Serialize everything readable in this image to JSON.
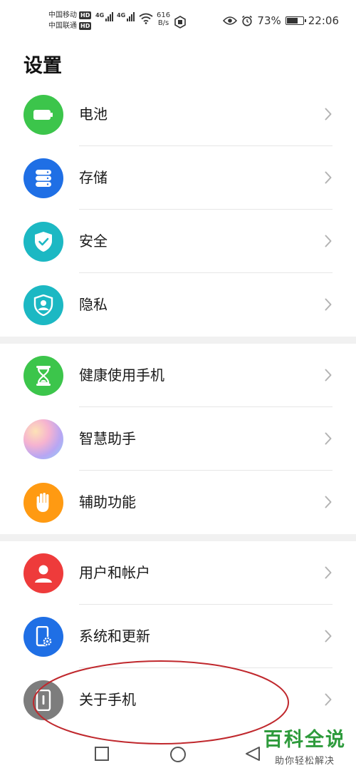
{
  "status_bar": {
    "carrier_1": "中国移动",
    "carrier_2": "中国联通",
    "hd": "HD",
    "network_1": "4G",
    "network_2": "4G",
    "speed_value": "616",
    "speed_unit": "B/s",
    "battery_percent": "73%",
    "battery_level": 0.73,
    "time": "22:06",
    "icons": [
      "eye-icon",
      "alarm-icon",
      "wifi-icon",
      "signal-icon",
      "battery-icon"
    ]
  },
  "header": {
    "title": "设置"
  },
  "groups": [
    {
      "items": [
        {
          "label": "电池",
          "icon": "battery-icon",
          "color": "#3cc54b"
        },
        {
          "label": "存储",
          "icon": "storage-icon",
          "color": "#1f6fe5"
        },
        {
          "label": "安全",
          "icon": "shield-check-icon",
          "color": "#1cb8c3"
        },
        {
          "label": "隐私",
          "icon": "privacy-icon",
          "color": "#1cb8c3"
        }
      ]
    },
    {
      "items": [
        {
          "label": "健康使用手机",
          "icon": "hourglass-icon",
          "color": "#3cc54b"
        },
        {
          "label": "智慧助手",
          "icon": "assistant-icon",
          "color": "#d7a3e8"
        },
        {
          "label": "辅助功能",
          "icon": "hand-icon",
          "color": "#ff9a12"
        }
      ]
    },
    {
      "items": [
        {
          "label": "用户和帐户",
          "icon": "user-icon",
          "color": "#ee3b3b"
        },
        {
          "label": "系统和更新",
          "icon": "phone-settings-icon",
          "color": "#1f6fe5"
        },
        {
          "label": "关于手机",
          "icon": "phone-info-icon",
          "color": "#7d7d7d"
        }
      ]
    }
  ],
  "nav_bar": {
    "buttons": [
      "recents-button",
      "home-button",
      "back-button"
    ]
  },
  "watermark": {
    "title": "百科全说",
    "subtitle": "助你轻松解决"
  },
  "colors": {
    "chevron": "#b3b3b3",
    "annotation": "#c0282d",
    "watermark": "#2e9b3c"
  }
}
